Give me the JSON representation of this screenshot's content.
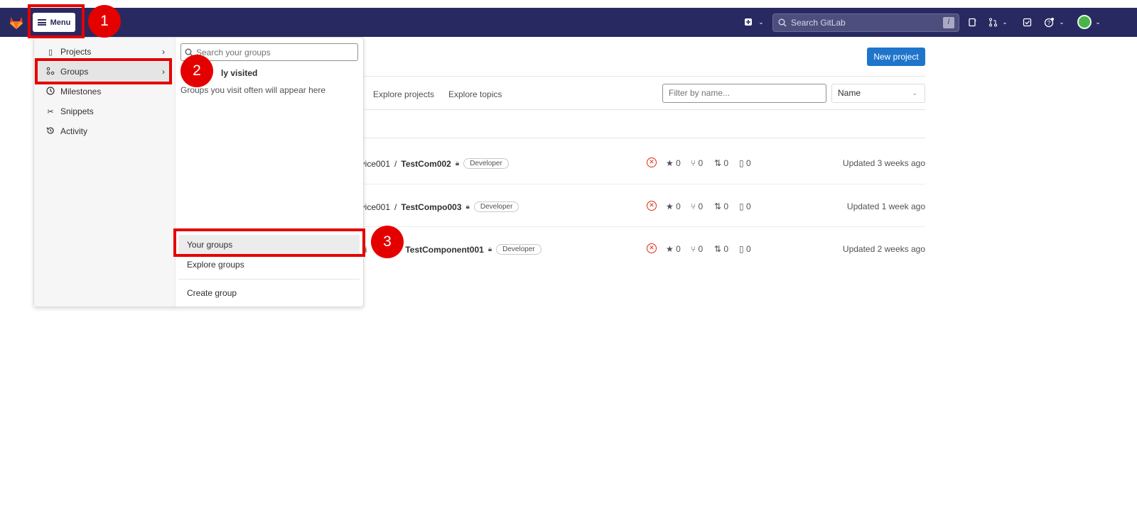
{
  "topbar": {
    "menu_label": "Menu",
    "search_placeholder": "Search GitLab",
    "search_shortcut": "/"
  },
  "main": {
    "new_project_label": "New project",
    "tabs": [
      {
        "label": "Explore projects"
      },
      {
        "label": "Explore topics"
      }
    ],
    "filter_placeholder": "Filter by name...",
    "sort_value": "Name",
    "projects": [
      {
        "namespace": "ervice001",
        "separator": "/",
        "name": "TestCom002",
        "role": "Developer",
        "stars": "0",
        "forks": "0",
        "merge_requests": "0",
        "issues": "0",
        "updated": "Updated 3 weeks ago"
      },
      {
        "namespace": "ervice001",
        "separator": "/",
        "name": "TestCompo003",
        "role": "Developer",
        "stars": "0",
        "forks": "0",
        "merge_requests": "0",
        "issues": "0",
        "updated": "Updated 1 week ago"
      },
      {
        "namespace": "ervi",
        "separator": "",
        "name": "TestComponent001",
        "role": "Developer",
        "stars": "0",
        "forks": "0",
        "merge_requests": "0",
        "issues": "0",
        "updated": "Updated 2 weeks ago"
      }
    ]
  },
  "menu": {
    "items": [
      {
        "label": "Projects",
        "icon": "project-icon"
      },
      {
        "label": "Groups",
        "icon": "group-icon"
      },
      {
        "label": "Milestones",
        "icon": "clock-icon"
      },
      {
        "label": "Snippets",
        "icon": "scissors-icon"
      },
      {
        "label": "Activity",
        "icon": "history-icon"
      }
    ],
    "groups_panel": {
      "search_placeholder": "Search your groups",
      "frequent_title": "ly visited",
      "frequent_empty": "Groups you visit often will appear here",
      "your_groups": "Your groups",
      "explore_groups": "Explore groups",
      "create_group": "Create group"
    }
  },
  "annotations": [
    "1",
    "2",
    "3"
  ],
  "colors": {
    "topbar": "#292961",
    "primary": "#1f75cb",
    "highlight": "#e50000",
    "fail": "#dd2b0e"
  }
}
